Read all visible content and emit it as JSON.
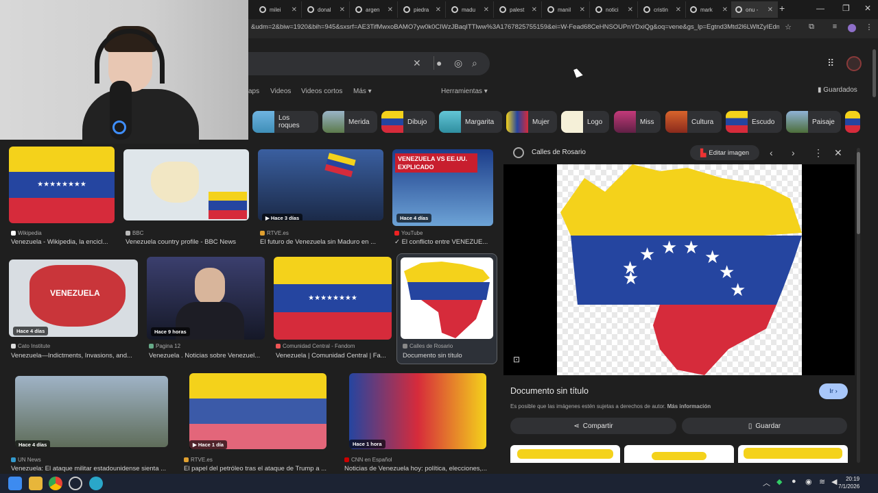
{
  "tabs": [
    {
      "label": "milei"
    },
    {
      "label": "donal"
    },
    {
      "label": "argen"
    },
    {
      "label": "piedra"
    },
    {
      "label": "madu"
    },
    {
      "label": "palest"
    },
    {
      "label": "manil"
    },
    {
      "label": "notici"
    },
    {
      "label": "cristin"
    },
    {
      "label": "mark"
    },
    {
      "label": "onu -"
    }
  ],
  "tab_close": "✕",
  "new_tab": "+",
  "address": {
    "url": "&udm=2&biw=1920&bih=945&sxsrf=AE3TifMwxoBAMO7yw0k0CIWzJBaqITTlww%3A1767825755159&ei=W-Fead68CeHNSOUPnYDxiQg&oq=vene&gs_lp=Egtnd3Mtd2l6LWltZyIEdmV..."
  },
  "filters": {
    "maps": "aps",
    "videos": "Videos",
    "short_videos": "Videos cortos",
    "more": "Más",
    "tools": "Herramientas",
    "saved": "Guardados"
  },
  "chips": [
    {
      "label": "Los roques"
    },
    {
      "label": "Merida"
    },
    {
      "label": "Dibujo"
    },
    {
      "label": "Margarita"
    },
    {
      "label": "Mujer"
    },
    {
      "label": "Logo"
    },
    {
      "label": "Miss"
    },
    {
      "label": "Cultura"
    },
    {
      "label": "Escudo"
    },
    {
      "label": "Paisaje"
    }
  ],
  "results": [
    {
      "source": "Wikipedia",
      "title": "Venezuela - Wikipedia, la encicl...",
      "badge": ""
    },
    {
      "source": "BBC",
      "title": "Venezuela country profile - BBC News",
      "badge": ""
    },
    {
      "source": "RTVE.es",
      "title": "El futuro de Venezuela sin Maduro en ...",
      "badge": "Hace 3 días"
    },
    {
      "source": "YouTube",
      "title": "✓ El conflicto entre VENEZUE...",
      "badge": "Hace 4 días",
      "thumb_text": "VENEZUELA VS EE.UU. EXPLICADO"
    },
    {
      "source": "Cato Institute",
      "title": "Venezuela—Indictments, Invasions, and...",
      "badge": "Hace 4 días",
      "map_label": "VENEZUELA"
    },
    {
      "source": "Pagina 12",
      "title": "Venezuela . Noticias sobre Venezuel...",
      "badge": "Hace 9 horas"
    },
    {
      "source": "Comunidad Central - Fandom",
      "title": "Venezuela | Comunidad Central | Fa...",
      "badge": ""
    },
    {
      "source": "Calles de Rosario",
      "title": "Documento sin título",
      "badge": ""
    },
    {
      "source": "UN News",
      "title": "Venezuela: El ataque militar estadounidense sienta ...",
      "badge": "Hace 4 días"
    },
    {
      "source": "RTVE.es",
      "title": "El papel del petróleo tras el ataque de Trump a ...",
      "badge": "Hace 1 día"
    },
    {
      "source": "CNN en Español",
      "title": "Noticias de Venezuela hoy: política, elecciones,...",
      "badge": "Hace 1 hora"
    }
  ],
  "preview": {
    "source": "Calles de Rosario",
    "edit_label": "Editar imagen",
    "title": "Documento sin título",
    "copyright": "Es posible que las imágenes estén sujetas a derechos de autor.",
    "more_info": "Más información",
    "go_label": "Ir",
    "share_label": "Compartir",
    "save_label": "Guardar"
  },
  "clock": {
    "time": "20:19",
    "date": "7/1/2026"
  },
  "colors": {
    "flag_yellow": "#f4d21b",
    "flag_blue": "#2545a0",
    "flag_red": "#d62b3b",
    "accent": "#a8c7fa"
  }
}
